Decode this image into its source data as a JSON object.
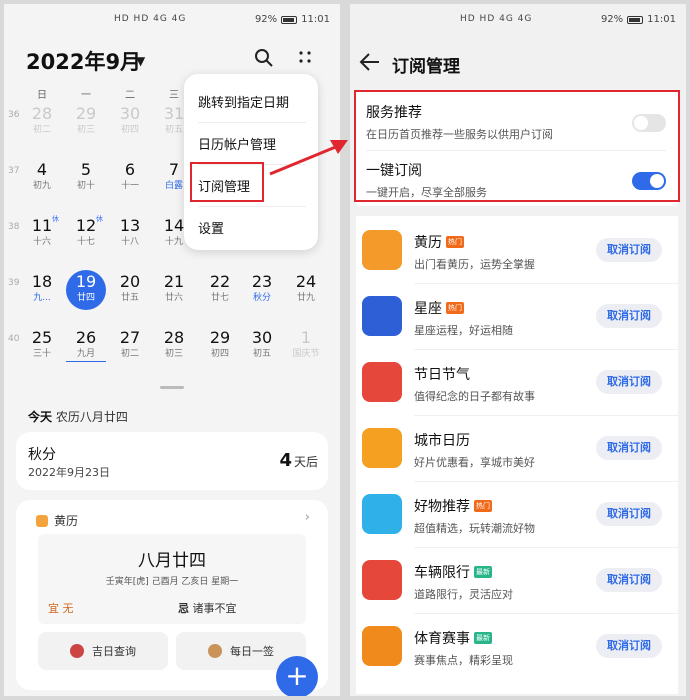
{
  "status": {
    "signal": "HD HD 4G 4G",
    "battery": "92%",
    "time": "11:01"
  },
  "left": {
    "month_title": "2022年9月",
    "weekdays": [
      "日",
      "一",
      "二",
      "三"
    ],
    "weeks": [
      {
        "num": "36",
        "days": [
          {
            "d": "28",
            "l": "初二",
            "f": true
          },
          {
            "d": "29",
            "l": "初三",
            "f": true
          },
          {
            "d": "30",
            "l": "初四",
            "f": true
          },
          {
            "d": "31",
            "l": "初五",
            "f": true
          },
          {
            "d": "",
            "l": ""
          },
          {
            "d": "",
            "l": ""
          },
          {
            "d": "",
            "l": ""
          }
        ]
      },
      {
        "num": "37",
        "days": [
          {
            "d": "4",
            "l": "初九"
          },
          {
            "d": "5",
            "l": "初十"
          },
          {
            "d": "6",
            "l": "十一"
          },
          {
            "d": "7",
            "l": "白露",
            "b": true
          },
          {
            "d": "",
            "l": ""
          },
          {
            "d": "",
            "l": ""
          },
          {
            "d": "",
            "l": ""
          }
        ]
      },
      {
        "num": "38",
        "days": [
          {
            "d": "11",
            "l": "十六",
            "s": "休"
          },
          {
            "d": "12",
            "l": "十七",
            "s": "休"
          },
          {
            "d": "13",
            "l": "十八"
          },
          {
            "d": "14",
            "l": "十九"
          },
          {
            "d": "",
            "l": ""
          },
          {
            "d": "",
            "l": ""
          },
          {
            "d": "",
            "l": ""
          }
        ]
      },
      {
        "num": "39",
        "days": [
          {
            "d": "18",
            "l": "九...",
            "b": true
          },
          {
            "d": "19",
            "l": "廿四",
            "t": true
          },
          {
            "d": "20",
            "l": "廿五"
          },
          {
            "d": "21",
            "l": "廿六"
          },
          {
            "d": "22",
            "l": "廿七"
          },
          {
            "d": "23",
            "l": "秋分",
            "b": true
          },
          {
            "d": "24",
            "l": "廿九"
          }
        ]
      },
      {
        "num": "40",
        "days": [
          {
            "d": "25",
            "l": "三十"
          },
          {
            "d": "26",
            "l": "九月",
            "u": true
          },
          {
            "d": "27",
            "l": "初二"
          },
          {
            "d": "28",
            "l": "初三"
          },
          {
            "d": "29",
            "l": "初四"
          },
          {
            "d": "30",
            "l": "初五"
          },
          {
            "d": "1",
            "l": "国庆节",
            "f": true
          }
        ]
      }
    ],
    "today_prefix": "今天",
    "today_lunar": "农历八月廿四",
    "event": {
      "title": "秋分",
      "date": "2022年9月23日",
      "days": "4",
      "unit": "天后"
    },
    "almanac": {
      "header": "黄历",
      "big": "八月廿四",
      "mini": "壬寅年[虎] 己酉月 乙亥日 星期一",
      "yi_label": "宜",
      "yi_value": "无",
      "ji_label": "忌",
      "ji_value": "诸事不宜",
      "btn1": "吉日查询",
      "btn2": "每日一签"
    },
    "fab": "+",
    "menu": [
      "跳转到指定日期",
      "日历帐户管理",
      "订阅管理",
      "设置"
    ]
  },
  "right": {
    "title": "订阅管理",
    "rows": [
      {
        "title": "服务推荐",
        "sub": "在日历首页推荐一些服务以供用户订阅",
        "on": false
      },
      {
        "title": "一键订阅",
        "sub": "一键开启，尽享全部服务",
        "on": true
      }
    ],
    "unsub_label": "取消订阅",
    "services": [
      {
        "name": "黄历",
        "desc": "出门看黄历，运势全掌握",
        "tag": "热门",
        "tagtype": "hot",
        "color": "#f39a2b"
      },
      {
        "name": "星座",
        "desc": "星座运程，好运相随",
        "tag": "热门",
        "tagtype": "hot",
        "color": "#2f5fd6"
      },
      {
        "name": "节日节气",
        "desc": "值得纪念的日子都有故事",
        "tag": "",
        "tagtype": "",
        "color": "#e5473b"
      },
      {
        "name": "城市日历",
        "desc": "好片优惠看，享城市美好",
        "tag": "",
        "tagtype": "",
        "color": "#f5a020"
      },
      {
        "name": "好物推荐",
        "desc": "超值精选，玩转潮流好物",
        "tag": "热门",
        "tagtype": "hot",
        "color": "#2fb0e8"
      },
      {
        "name": "车辆限行",
        "desc": "道路限行，灵活应对",
        "tag": "最新",
        "tagtype": "new",
        "color": "#e5473b"
      },
      {
        "name": "体育赛事",
        "desc": "赛事焦点，精彩呈现",
        "tag": "最新",
        "tagtype": "new",
        "color": "#f08a1c"
      }
    ]
  },
  "colors": {
    "accent": "#2f6ae8",
    "highlight": "#e0262f"
  }
}
